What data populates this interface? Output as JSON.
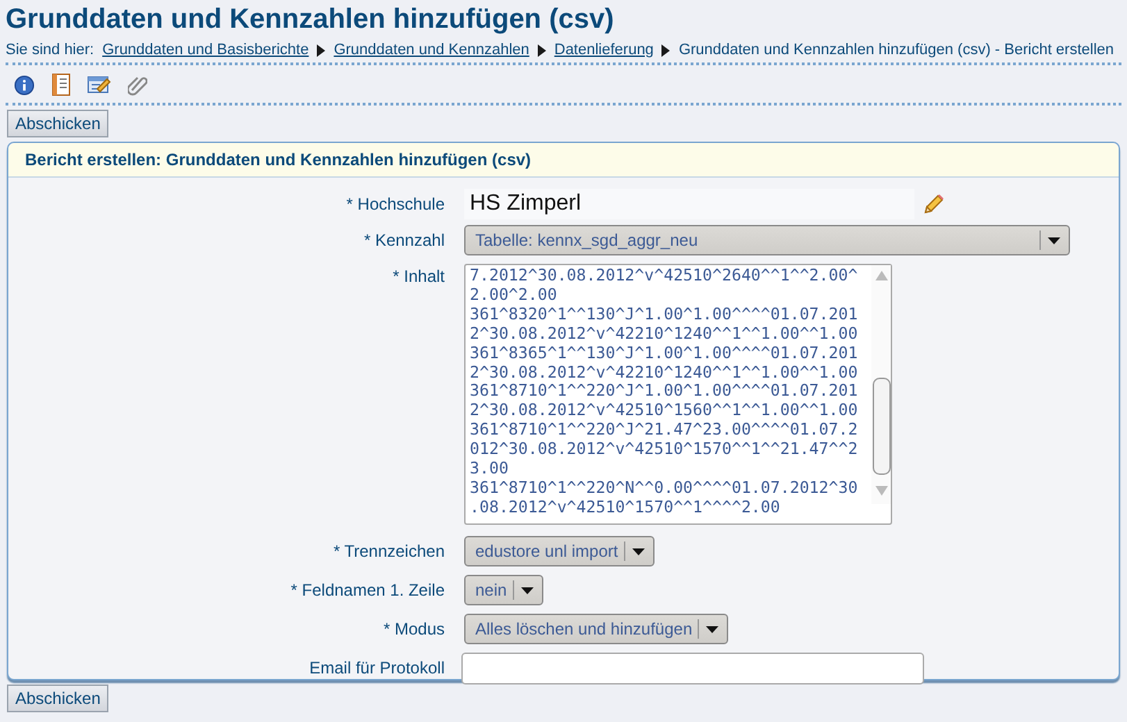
{
  "page_title": "Grunddaten und Kennzahlen hinzufügen (csv)",
  "breadcrumb": {
    "prefix": "Sie sind hier:",
    "links": [
      "Grunddaten und Basisberichte",
      "Grunddaten und Kennzahlen",
      "Datenlieferung"
    ],
    "current": "Grunddaten und Kennzahlen hinzufügen (csv) - Bericht erstellen"
  },
  "toolbar": [
    {
      "kind": "info"
    },
    {
      "kind": "notes"
    },
    {
      "kind": "edit"
    },
    {
      "kind": "attach"
    }
  ],
  "submit_top": "Abschicken",
  "panel": {
    "title": "Bericht erstellen: Grunddaten und Kennzahlen hinzufügen (csv)",
    "fields": [
      {
        "kind": "static",
        "label": "* Hochschule",
        "value": "HS Zimperl"
      },
      {
        "kind": "select-wide",
        "label": "* Kennzahl",
        "value": "Tabelle: kennx_sgd_aggr_neu"
      },
      {
        "kind": "textarea",
        "label": "* Inhalt",
        "lines": [
          "7.2012^30.08.2012^v^42510^2640^^1^^2.00^",
          "2.00^2.00",
          "361^8320^1^^130^J^1.00^1.00^^^^01.07.201",
          "2^30.08.2012^v^42210^1240^^1^^1.00^^1.00",
          "361^8365^1^^130^J^1.00^1.00^^^^01.07.201",
          "2^30.08.2012^v^42210^1240^^1^^1.00^^1.00",
          "361^8710^1^^220^J^1.00^1.00^^^^01.07.201",
          "2^30.08.2012^v^42510^1560^^1^^1.00^^1.00",
          "361^8710^1^^220^J^21.47^23.00^^^^01.07.2",
          "012^30.08.2012^v^42510^1570^^1^^21.47^^2",
          "3.00",
          "361^8710^1^^220^N^^0.00^^^^01.07.2012^30",
          ".08.2012^v^42510^1570^^1^^^^2.00"
        ]
      },
      {
        "kind": "select",
        "label": "* Trennzeichen",
        "value": "edustore unl import"
      },
      {
        "kind": "select",
        "label": "* Feldnamen 1. Zeile",
        "value": "nein"
      },
      {
        "kind": "select",
        "label": "* Modus",
        "value": "Alles löschen und hinzufügen"
      },
      {
        "kind": "input",
        "label": "Email für Protokoll"
      }
    ]
  },
  "submit_bottom": "Abschicken"
}
